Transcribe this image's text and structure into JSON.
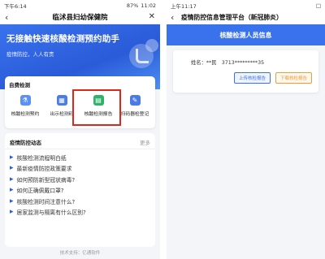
{
  "left": {
    "status": {
      "time": "下午6:14",
      "battery": "87%",
      "clock": "11:02"
    },
    "titlebar": {
      "back_icon": "‹",
      "title": "临沭县妇幼保健院",
      "close_icon": "✕"
    },
    "banner": {
      "headline": "无接触快速核酸检测预约助手",
      "sub": "疫情防控，人人有责"
    },
    "self_test": {
      "section_title": "自费检测",
      "tiles": [
        {
          "label": "核酸检测预约",
          "color": "#5b8ff9",
          "glyph": "⚗"
        },
        {
          "label": "出示检测码",
          "color": "#4a7be6",
          "glyph": "▦"
        },
        {
          "label": "核酸检测报告",
          "color": "#2fb36b",
          "glyph": "▤"
        },
        {
          "label": "扫码器检登记",
          "color": "#4a7be6",
          "glyph": "✎"
        }
      ]
    },
    "news": {
      "title": "疫情防控动态",
      "more": "更多",
      "items": [
        "核酸检测流程明白纸",
        "最新疫情防控政策要求",
        "如何预防新型冠状病毒?",
        "如何正确佩戴口罩?",
        "核酸检测时间注意什么?",
        "居家监测与隔离有什么区别?"
      ]
    },
    "footer": "技术支持：亿通软件"
  },
  "right": {
    "status": {
      "time": "上午11:17",
      "battery": "□"
    },
    "titlebar": {
      "back_icon": "‹",
      "title": "疫情防控信息管理平台（新冠肺炎）"
    },
    "banner": "核酸检测人员信息",
    "person": {
      "label": "姓名：**民　3713*********35"
    },
    "buttons": {
      "upload": "上传核检报告",
      "download": "下载核检报告"
    }
  }
}
